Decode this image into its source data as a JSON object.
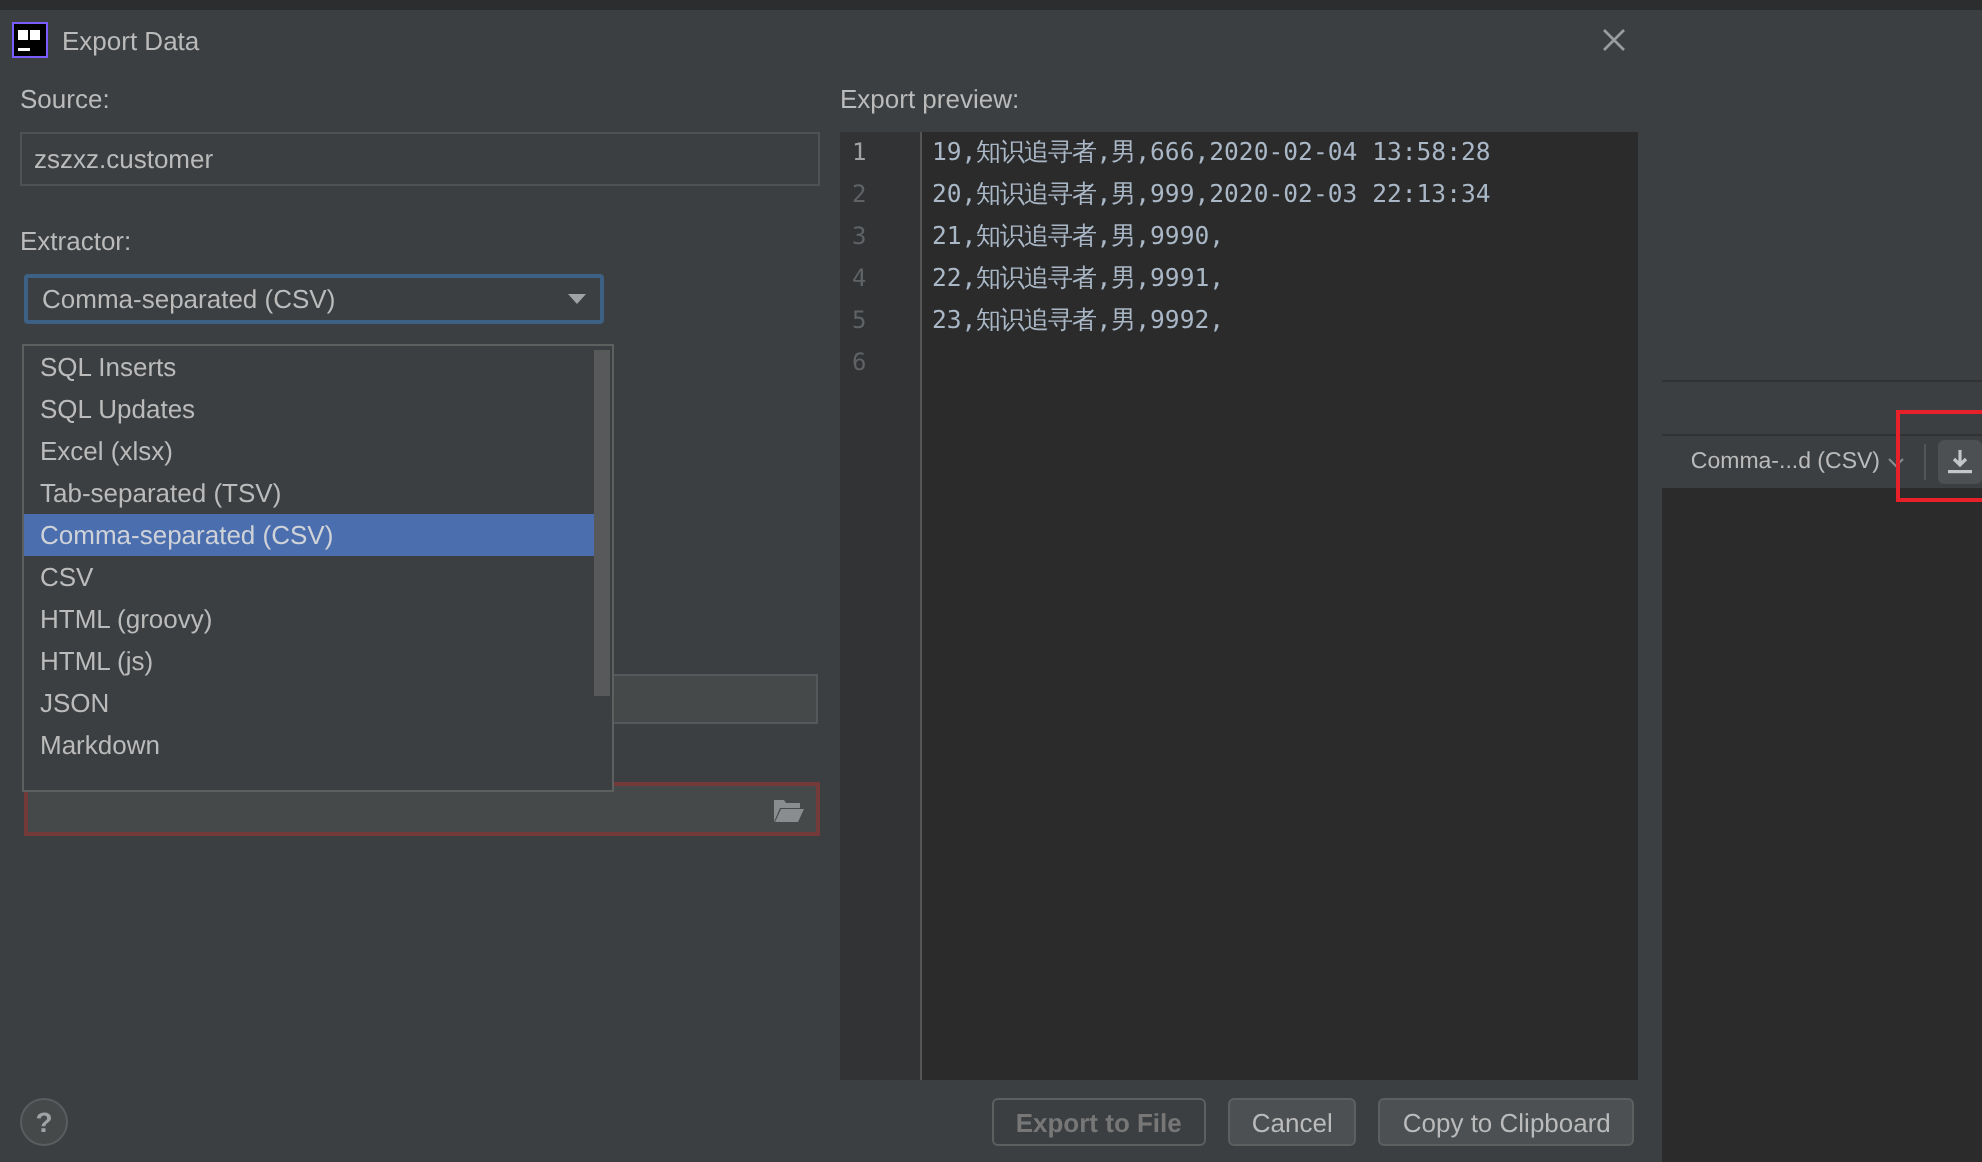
{
  "window": {
    "title": "Export Data"
  },
  "source": {
    "label": "Source:",
    "value": "zszxz.customer"
  },
  "extractor": {
    "label": "Extractor:",
    "value": "Comma-separated (CSV)",
    "expanded": true,
    "options": [
      {
        "label": "SQL Inserts",
        "selected": false
      },
      {
        "label": "SQL Updates",
        "selected": false
      },
      {
        "label": "Excel (xlsx)",
        "selected": false
      },
      {
        "label": "Tab-separated (TSV)",
        "selected": false
      },
      {
        "label": "Comma-separated (CSV)",
        "selected": true
      },
      {
        "label": "CSV",
        "selected": false
      },
      {
        "label": "HTML (groovy)",
        "selected": false
      },
      {
        "label": "HTML (js)",
        "selected": false
      },
      {
        "label": "JSON",
        "selected": false
      },
      {
        "label": "Markdown",
        "selected": false
      }
    ]
  },
  "output_file": {
    "invalid": true
  },
  "preview": {
    "label": "Export preview:",
    "lines": [
      {
        "number": "1",
        "text": "19,知识追寻者,男,666,2020-02-04 13:58:28",
        "current": true
      },
      {
        "number": "2",
        "text": "20,知识追寻者,男,999,2020-02-03 22:13:34",
        "current": false
      },
      {
        "number": "3",
        "text": "21,知识追寻者,男,9990,",
        "current": false
      },
      {
        "number": "4",
        "text": "22,知识追寻者,男,9991,",
        "current": false
      },
      {
        "number": "5",
        "text": "23,知识追寻者,男,9992,",
        "current": false
      },
      {
        "number": "6",
        "current": false
      }
    ]
  },
  "help": "?",
  "buttons": [
    {
      "label": "Export to File",
      "disabled": true
    },
    {
      "label": "Cancel",
      "disabled": false
    },
    {
      "label": "Copy to Clipboard",
      "disabled": false
    }
  ],
  "background_toolbar": {
    "format": "Comma-...d (CSV)"
  }
}
